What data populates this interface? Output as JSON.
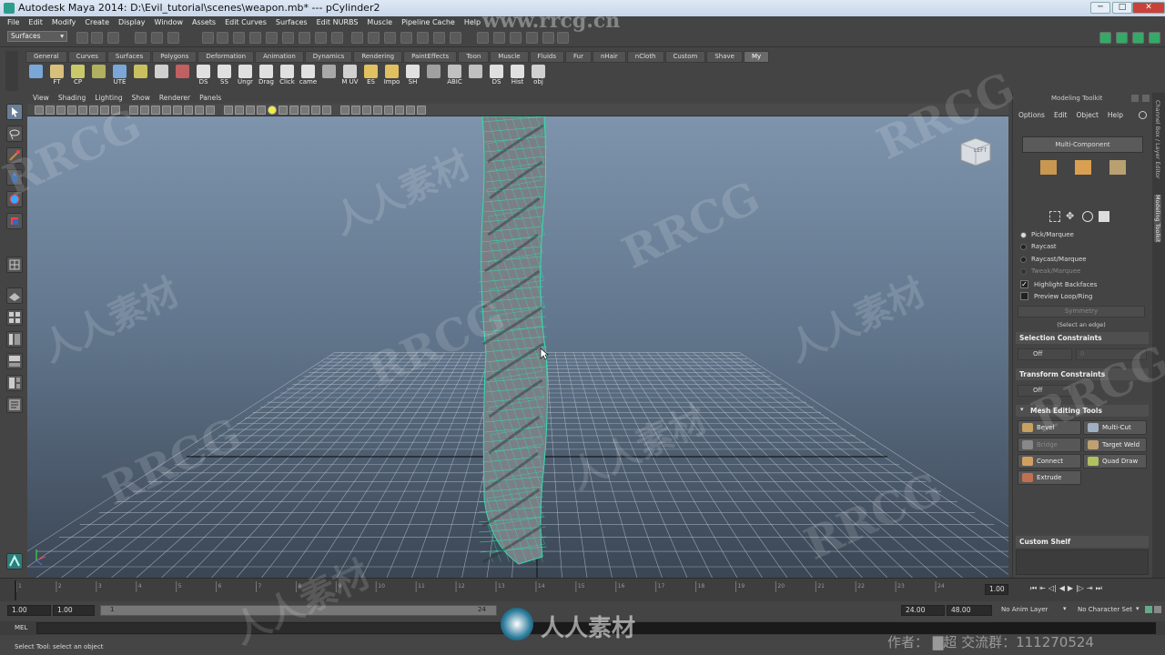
{
  "window": {
    "title": "Autodesk Maya 2014: D:\\Evil_tutorial\\scenes\\weapon.mb*  ---  pCylinder2",
    "minimize": "─",
    "maximize": "□",
    "close": "✕"
  },
  "menubar": [
    "File",
    "Edit",
    "Modify",
    "Create",
    "Display",
    "Window",
    "Assets",
    "Edit Curves",
    "Surfaces",
    "Edit NURBS",
    "Muscle",
    "Pipeline Cache",
    "Help"
  ],
  "statusline": {
    "mode": "Surfaces"
  },
  "shelf_tabs": [
    "General",
    "Curves",
    "Surfaces",
    "Polygons",
    "Deformation",
    "Animation",
    "Dynamics",
    "Rendering",
    "PaintEffects",
    "Toon",
    "Muscle",
    "Fluids",
    "Fur",
    "nHair",
    "nCloth",
    "Custom",
    "Shave",
    "My"
  ],
  "shelf_active": "My",
  "shelf_items": [
    {
      "label": "",
      "color": "#7aa6d8"
    },
    {
      "label": "FT",
      "color": "#d8c07a"
    },
    {
      "label": "CP",
      "color": "#c9c96a"
    },
    {
      "label": "",
      "color": "#b0b060"
    },
    {
      "label": "UTE",
      "color": "#7aa6d8"
    },
    {
      "label": "",
      "color": "#c8c060"
    },
    {
      "label": "",
      "color": "#d0d0d0"
    },
    {
      "label": "",
      "color": "#c06060"
    },
    {
      "label": "DS",
      "color": "#e0e0e0"
    },
    {
      "label": "SS",
      "color": "#e0e0e0"
    },
    {
      "label": "Ungr",
      "color": "#e0e0e0"
    },
    {
      "label": "Drag",
      "color": "#e0e0e0"
    },
    {
      "label": "Click",
      "color": "#e0e0e0"
    },
    {
      "label": "came",
      "color": "#e0e0e0"
    },
    {
      "label": "",
      "color": "#a8a8a8"
    },
    {
      "label": "M UV",
      "color": "#d0d0d0"
    },
    {
      "label": "ES",
      "color": "#e0c060"
    },
    {
      "label": "Impo",
      "color": "#e0c060"
    },
    {
      "label": "SH",
      "color": "#e0e0e0"
    },
    {
      "label": "",
      "color": "#a0a0a0"
    },
    {
      "label": "ABIC",
      "color": "#c0c0c0"
    },
    {
      "label": "",
      "color": "#c0c0c0"
    },
    {
      "label": "DS",
      "color": "#e0e0e0"
    },
    {
      "label": "Hist",
      "color": "#e0e0e0"
    },
    {
      "label": "obj",
      "color": "#d0d0d0"
    }
  ],
  "panel_menu": [
    "View",
    "Shading",
    "Lighting",
    "Show",
    "Renderer",
    "Panels"
  ],
  "viewcube": {
    "label": "LEFT"
  },
  "toolkit": {
    "title": "Modeling Toolkit",
    "menu": [
      "Options",
      "Edit",
      "Object",
      "Help"
    ],
    "mode_button": "Multi-Component",
    "selection_modes": [
      "Pick/Marquee",
      "Raycast",
      "Raycast/Marquee",
      "Tweak/Marquee"
    ],
    "highlight_backfaces": "Highlight Backfaces",
    "preview_loop": "Preview Loop/Ring",
    "symmetry": "Symmetry",
    "select_edge_hint": "(Select an edge)",
    "selection_constraints": {
      "title": "Selection Constraints",
      "value": "Off",
      "field": "0"
    },
    "transform_constraints": {
      "title": "Transform Constraints",
      "value": "Off"
    },
    "mesh_editing": {
      "title": "Mesh Editing Tools",
      "tools": [
        "Bevel",
        "Multi-Cut",
        "Bridge",
        "Target Weld",
        "Connect",
        "Quad Draw",
        "Extrude"
      ]
    },
    "custom_shelf": "Custom Shelf"
  },
  "side_tabs": [
    "Channel Box / Layer Editor",
    "Modeling Toolkit"
  ],
  "timeline": {
    "ticks": [
      "1",
      "2",
      "3",
      "4",
      "5",
      "6",
      "7",
      "8",
      "9",
      "10",
      "11",
      "12",
      "13",
      "14",
      "15",
      "16",
      "17",
      "18",
      "19",
      "20",
      "21",
      "22",
      "23",
      "24"
    ],
    "current": "1.00"
  },
  "range": {
    "start": "1.00",
    "playback_start": "1.00",
    "slider_start": "1",
    "slider_end": "24",
    "playback_end": "24.00",
    "end": "48.00",
    "anim_layer": "No Anim Layer",
    "character_set": "No Character Set"
  },
  "mel_label": "MEL",
  "help_line": "Select Tool: select an object",
  "watermarks": {
    "site": "www.rrcg.cn",
    "brand": "RRCG",
    "chinese": "人人素材",
    "credit": "作者：  ▇超  交流群：111270524"
  }
}
